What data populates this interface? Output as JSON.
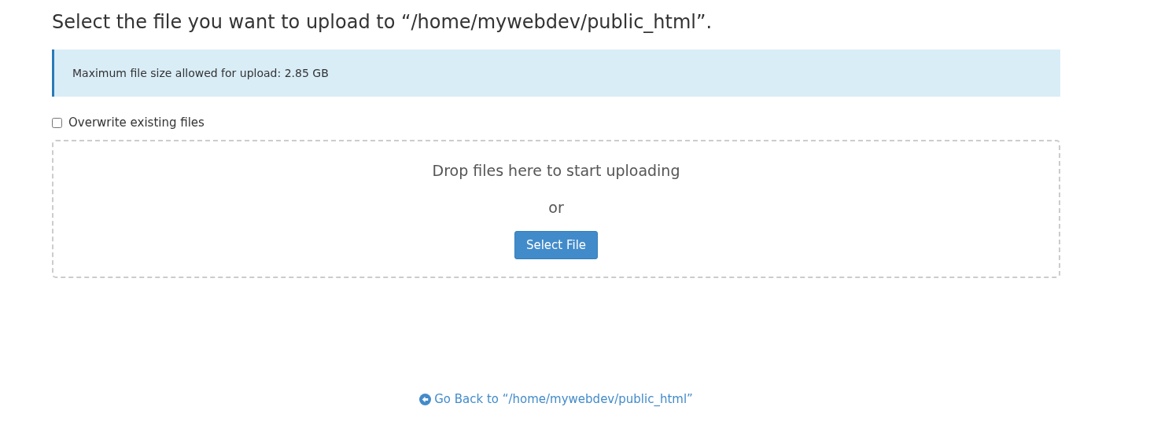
{
  "heading": "Select the file you want to upload to “/home/mywebdev/public_html”.",
  "notice": "Maximum file size allowed for upload: 2.85 GB",
  "overwrite": {
    "label": "Overwrite existing files",
    "checked": false
  },
  "dropzone": {
    "prompt": "Drop files here to start uploading",
    "or": "or",
    "button": "Select File"
  },
  "back_link": "Go Back to “/home/mywebdev/public_html”"
}
